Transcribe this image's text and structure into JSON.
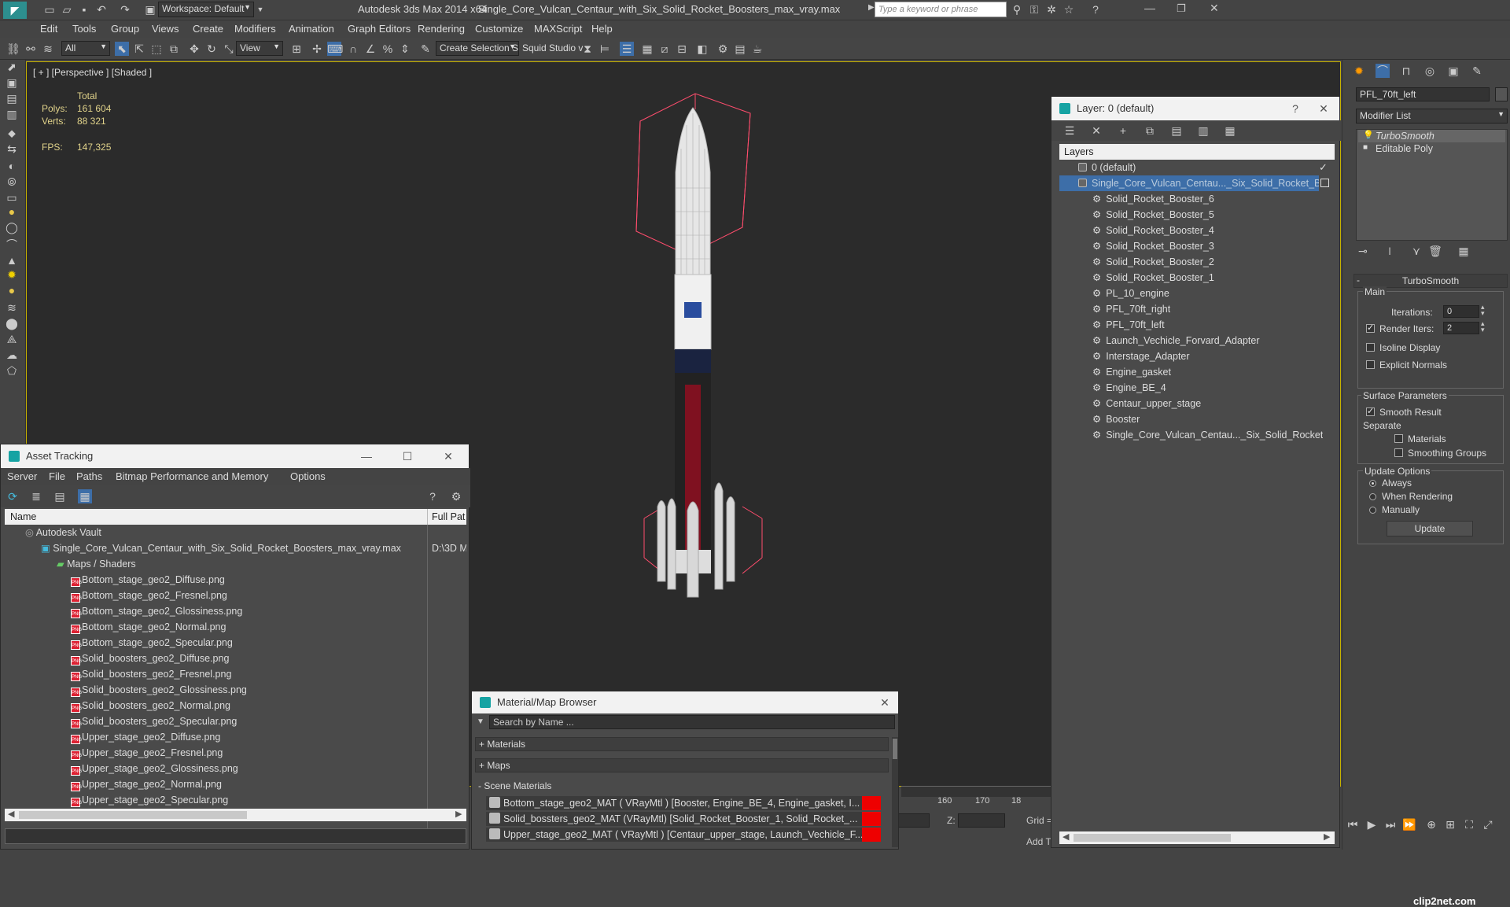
{
  "app": {
    "workspace": "Workspace: Default",
    "title": "Autodesk 3ds Max  2014 x64",
    "filename": "Single_Core_Vulcan_Centaur_with_Six_Solid_Rocket_Boosters_max_vray.max",
    "search_placeholder": "Type a keyword or phrase"
  },
  "menu": [
    "Edit",
    "Tools",
    "Group",
    "Views",
    "Create",
    "Modifiers",
    "Animation",
    "Graph Editors",
    "Rendering",
    "Customize",
    "MAXScript",
    "Help"
  ],
  "toolbar": {
    "filter": "All",
    "view": "View",
    "selection_set": "Create Selection Se",
    "squid": "Squid Studio v"
  },
  "viewport": {
    "label": "[ + ] [Perspective ] [Shaded ]",
    "stats_total": "Total",
    "polys_label": "Polys:",
    "polys": "161 604",
    "verts_label": "Verts:",
    "verts": "88 321",
    "fps_label": "FPS:",
    "fps": "147,325"
  },
  "asset_tracking": {
    "title": "Asset Tracking",
    "menu": [
      "Server",
      "File",
      "Paths",
      "Bitmap Performance and Memory",
      "Options"
    ],
    "col_name": "Name",
    "col_path": "Full Pat",
    "vault": "Autodesk Vault",
    "scene_file": "Single_Core_Vulcan_Centaur_with_Six_Solid_Rocket_Boosters_max_vray.max",
    "scene_path": "D:\\3D M",
    "maps_folder": "Maps / Shaders",
    "files": [
      "Bottom_stage_geo2_Diffuse.png",
      "Bottom_stage_geo2_Fresnel.png",
      "Bottom_stage_geo2_Glossiness.png",
      "Bottom_stage_geo2_Normal.png",
      "Bottom_stage_geo2_Specular.png",
      "Solid_boosters_geo2_Diffuse.png",
      "Solid_boosters_geo2_Fresnel.png",
      "Solid_boosters_geo2_Glossiness.png",
      "Solid_boosters_geo2_Normal.png",
      "Solid_boosters_geo2_Specular.png",
      "Upper_stage_geo2_Diffuse.png",
      "Upper_stage_geo2_Fresnel.png",
      "Upper_stage_geo2_Glossiness.png",
      "Upper_stage_geo2_Normal.png",
      "Upper_stage_geo2_Specular.png"
    ]
  },
  "material_browser": {
    "title": "Material/Map Browser",
    "search_placeholder": "Search by Name ...",
    "materials": "+ Materials",
    "maps": "+ Maps",
    "scene_materials": "- Scene Materials",
    "items": [
      "Bottom_stage_geo2_MAT ( VRayMtl ) [Booster, Engine_BE_4, Engine_gasket, I...",
      "Solid_bossters_geo2_MAT (VRayMtl) [Solid_Rocket_Booster_1, Solid_Rocket_...",
      "Upper_stage_geo2_MAT ( VRayMtl ) [Centaur_upper_stage, Launch_Vechicle_F..."
    ]
  },
  "layer_window": {
    "title": "Layer: 0 (default)",
    "header": "Layers",
    "default_layer": "0 (default)",
    "selected_layer": "Single_Core_Vulcan_Centau..._Six_Solid_Rocket_Bo",
    "objects": [
      "Solid_Rocket_Booster_6",
      "Solid_Rocket_Booster_5",
      "Solid_Rocket_Booster_4",
      "Solid_Rocket_Booster_3",
      "Solid_Rocket_Booster_2",
      "Solid_Rocket_Booster_1",
      "PL_10_engine",
      "PFL_70ft_right",
      "PFL_70ft_left",
      "Launch_Vechicle_Forvard_Adapter",
      "Interstage_Adapter",
      "Engine_gasket",
      "Engine_BE_4",
      "Centaur_upper_stage",
      "Booster",
      "Single_Core_Vulcan_Centau..._Six_Solid_Rocket"
    ]
  },
  "command_panel": {
    "object_name": "PFL_70ft_left",
    "modifier_list": "Modifier List",
    "stack": [
      "TurboSmooth",
      "Editable Poly"
    ],
    "rollout_title": "TurboSmooth",
    "main": "Main",
    "iterations_label": "Iterations:",
    "iterations": "0",
    "render_iters_label": "Render Iters:",
    "render_iters": "2",
    "isoline": "Isoline Display",
    "explicit_normals": "Explicit Normals",
    "surface_params": "Surface Parameters",
    "smooth_result": "Smooth Result",
    "separate": "Separate",
    "materials": "Materials",
    "smoothing_groups": "Smoothing Groups",
    "update_options": "Update Options",
    "always": "Always",
    "when_rendering": "When Rendering",
    "manually": "Manually",
    "update_btn": "Update"
  },
  "timeline": {
    "ticks": [
      "160",
      "170",
      "18"
    ],
    "z_label": "Z:",
    "grid": "Grid =",
    "add_t": "Add T"
  },
  "watermark": "clip2net.com"
}
